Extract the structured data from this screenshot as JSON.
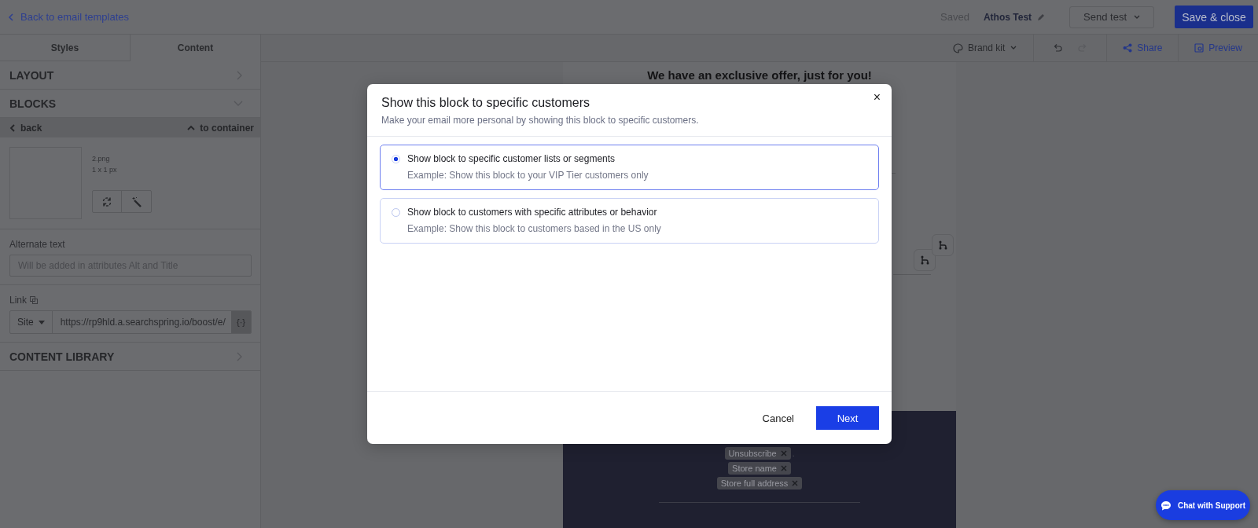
{
  "topbar": {
    "back_link": "Back to email templates",
    "save_status": "Saved",
    "template_name": "Athos Test",
    "send_test": "Send test",
    "save_close": "Save & close"
  },
  "tabs": [
    {
      "label": "Styles",
      "selected": false
    },
    {
      "label": "Content",
      "selected": true
    }
  ],
  "toolbar": {
    "brand_kit": "Brand kit",
    "share": "Share",
    "preview": "Preview"
  },
  "sidebar": {
    "sections": [
      {
        "label": "LAYOUT",
        "expanded": false
      },
      {
        "label": "BLOCKS",
        "expanded": true
      },
      {
        "label": "CONTENT LIBRARY",
        "expanded": false
      }
    ],
    "block_editor": {
      "back": "back",
      "to_container": "to container",
      "file_name": "2.png",
      "file_size": "1 x 1 px",
      "alt_label": "Alternate text",
      "alt_placeholder": "Will be added in attributes Alt and Title",
      "link_label": "Link",
      "link_type": "Site",
      "link_value": "https://rp9hld.a.searchspring.io/boost/e/",
      "variable_button": "{·}"
    }
  },
  "email": {
    "heading": "We have an exclusive offer, just for you!",
    "footer_tags": [
      {
        "label": "Unsubscribe",
        "suffix": "."
      },
      {
        "label": "Store name"
      },
      {
        "label": "Store full address"
      }
    ]
  },
  "modal": {
    "title": "Show this block to specific customers",
    "subtitle": "Make your email more personal by showing this block to specific customers.",
    "close": "×",
    "options": [
      {
        "label": "Show block to specific customer lists or segments",
        "example": "Example: Show this block to your VIP Tier customers only",
        "selected": true
      },
      {
        "label": "Show block to customers with specific attributes or behavior",
        "example": "Example: Show this block to customers based in the US only",
        "selected": false
      }
    ],
    "cancel": "Cancel",
    "next": "Next"
  },
  "chat_button": "Chat with Support"
}
